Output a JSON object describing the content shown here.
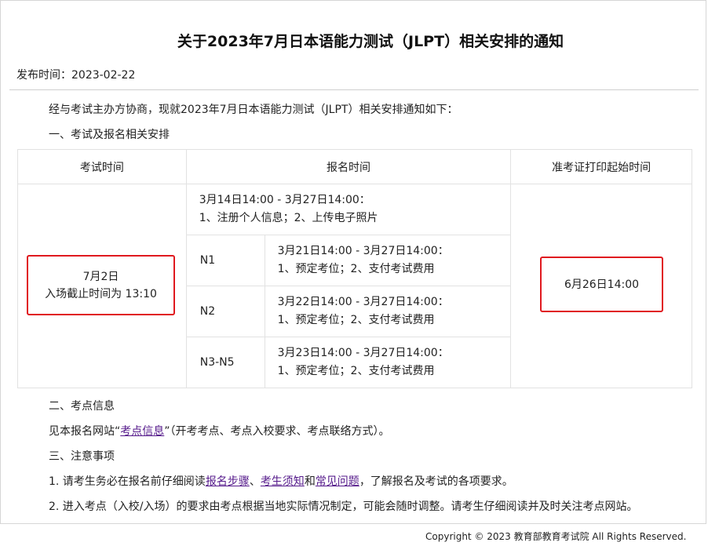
{
  "notice": {
    "title": "关于2023年7月日本语能力测试（JLPT）相关安排的通知",
    "publish_label": "发布时间：",
    "publish_date": "2023-02-22",
    "intro": "经与考试主办方协商，现就2023年7月日本语能力测试（JLPT）相关安排通知如下：",
    "section1": "一、考试及报名相关安排",
    "section2": "二、考点信息",
    "section2_text_before": "见本报名网站“",
    "section2_link": "考点信息",
    "section2_text_after": "”（开考考点、考点入校要求、考点联络方式）。",
    "section3": "三、注意事项",
    "note1_before": "1. 请考生务必在报名前仔细阅读",
    "note1_link1": "报名步骤",
    "note1_sep": "、",
    "note1_link2": "考生须知",
    "note1_and": "和",
    "note1_link3": "常见问题",
    "note1_after": "，了解报名及考试的各项要求。",
    "note2": "2. 进入考点（入校/入场）的要求由考点根据当地实际情况制定，可能会随时调整。请考生仔细阅读并及时关注考点网站。"
  },
  "table": {
    "headers": [
      "考试时间",
      "报名时间",
      "准考证打印起始时间"
    ],
    "exam_date": "7月2日",
    "exam_entry": "入场截止时间为 13:10",
    "registration_all_time": "3月14日14:00 - 3月27日14:00：",
    "registration_all_desc": "1、注册个人信息；2、上传电子照片",
    "levels": [
      {
        "level": "N1",
        "time": "3月21日14:00 - 3月27日14:00：",
        "desc": "1、预定考位；2、支付考试费用"
      },
      {
        "level": "N2",
        "time": "3月22日14:00 - 3月27日14:00：",
        "desc": "1、预定考位；2、支付考试费用"
      },
      {
        "level": "N3-N5",
        "time": "3月23日14:00 - 3月27日14:00：",
        "desc": "1、预定考位；2、支付考试费用"
      }
    ],
    "print_start": "6月26日14:00"
  },
  "footer": {
    "copyright": "Copyright © 2023 教育部教育考试院 All Rights Reserved."
  },
  "colors": {
    "highlight_box": "#e0191f",
    "link": "#551a8b",
    "border": "#e2e2e2"
  }
}
